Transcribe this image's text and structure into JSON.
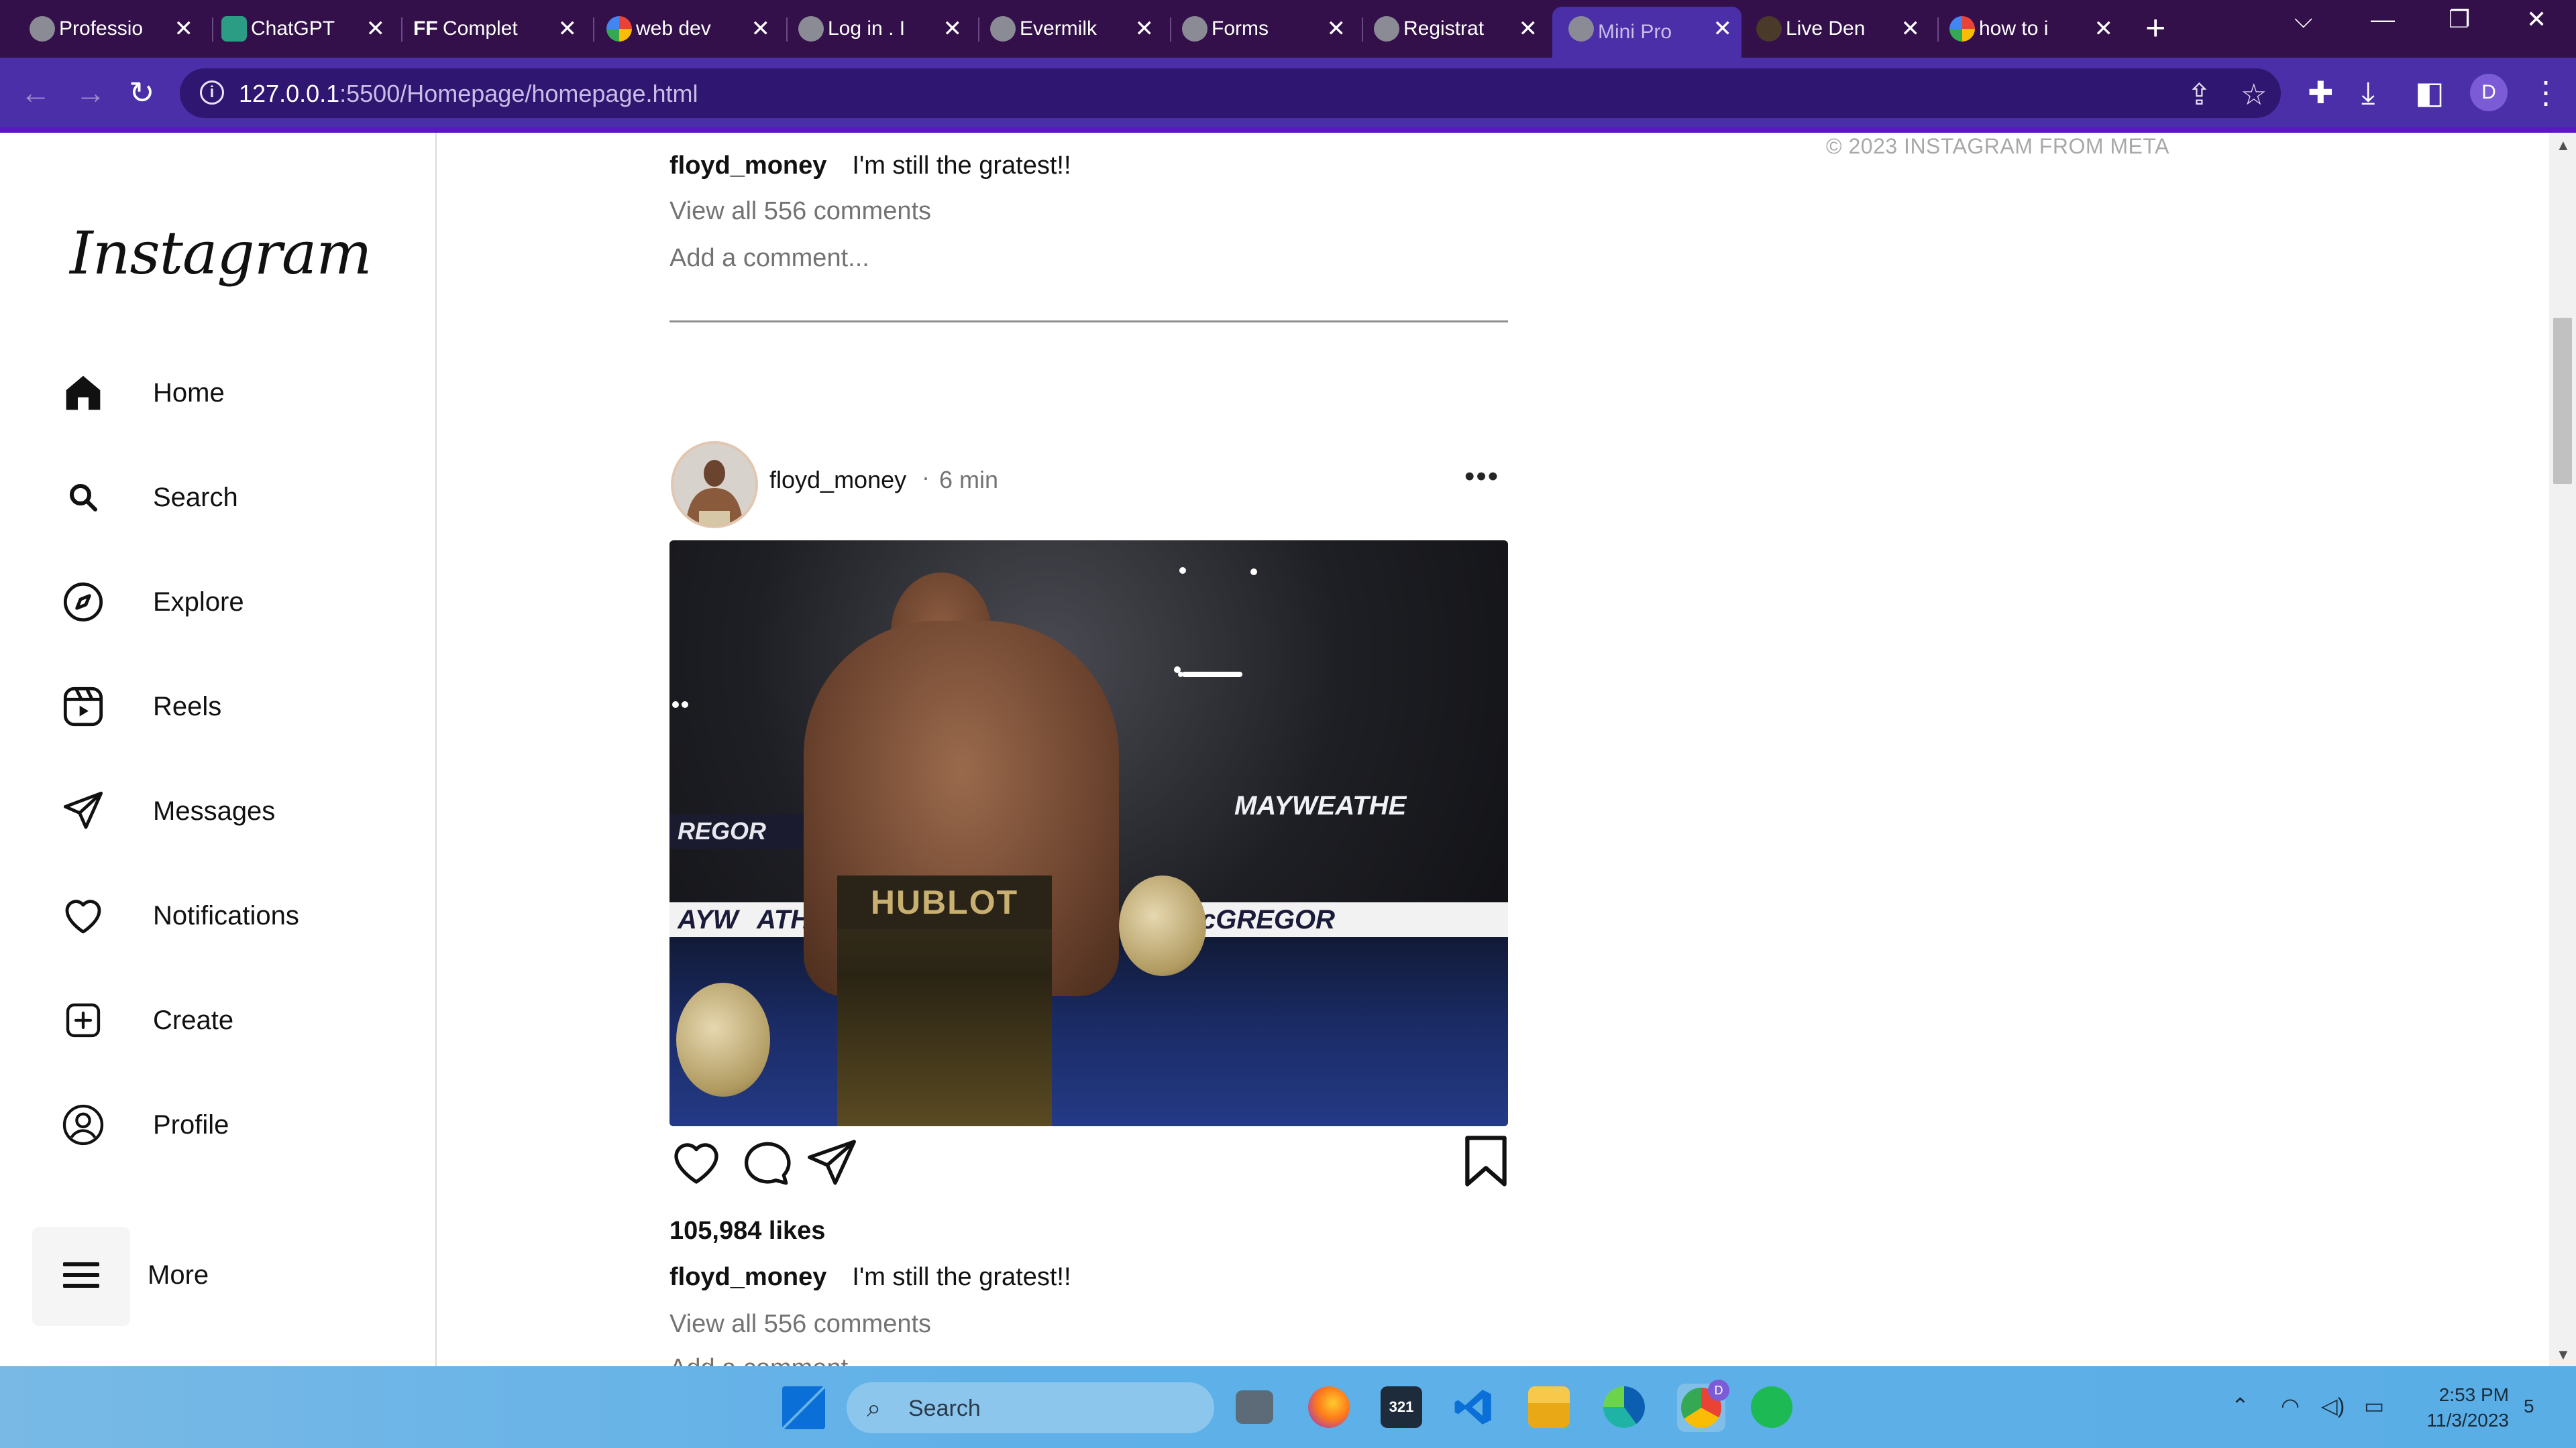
{
  "browser": {
    "tabs": [
      {
        "title": "Professio",
        "favicon": "globe-icon"
      },
      {
        "title": "ChatGPT",
        "favicon": "chatgpt-icon"
      },
      {
        "title": "Complet",
        "favicon": "ff-icon",
        "favicon_text": "FF"
      },
      {
        "title": "web dev",
        "favicon": "google-icon"
      },
      {
        "title": "Log in . I",
        "favicon": "globe-icon"
      },
      {
        "title": "Evermilk",
        "favicon": "globe-icon"
      },
      {
        "title": "Forms",
        "favicon": "globe-icon"
      },
      {
        "title": "Registrat",
        "favicon": "globe-icon"
      },
      {
        "title": "Mini Pro",
        "favicon": "globe-icon",
        "active": true
      },
      {
        "title": "Live Den",
        "favicon": "star-icon"
      },
      {
        "title": "how to i",
        "favicon": "google-icon"
      }
    ],
    "tab_close_glyph": "✕",
    "new_tab_glyph": "+",
    "url_host": "127.0.0.1",
    "url_path": ":5500/Homepage/homepage.html",
    "profile_initial": "D",
    "window_controls": {
      "chevron": "⌵",
      "minimize": "—",
      "restore": "❐",
      "close": "✕"
    }
  },
  "sidebar": {
    "logo": "Instagram",
    "items": [
      {
        "label": "Home",
        "icon": "home-icon"
      },
      {
        "label": "Search",
        "icon": "search-icon"
      },
      {
        "label": "Explore",
        "icon": "compass-icon"
      },
      {
        "label": "Reels",
        "icon": "reels-icon"
      },
      {
        "label": "Messages",
        "icon": "messages-icon"
      },
      {
        "label": "Notifications",
        "icon": "heart-icon"
      },
      {
        "label": "Create",
        "icon": "create-icon"
      },
      {
        "label": "Profile",
        "icon": "profile-icon"
      }
    ],
    "more_label": "More"
  },
  "feed": {
    "previous_post": {
      "caption_user": "floyd_money",
      "caption_text": "I'm still the gratest!!",
      "view_comments": "View all 556 comments",
      "add_comment_placeholder": "Add a comment..."
    },
    "post": {
      "username": "floyd_money",
      "separator": "·",
      "time": "6 min",
      "options_glyph": "•••",
      "image_banner_text": [
        "REGOR",
        "MAYWEATHE",
        "AYW",
        "ATH",
        "cGREGOR"
      ],
      "belt_text": "HUBLOT",
      "likes": "105,984 likes",
      "caption_user": "floyd_money",
      "caption_text": "I'm still the gratest!!",
      "view_comments": "View all 556 comments",
      "add_comment_placeholder": "Add a comment..."
    }
  },
  "right_column": {
    "copyright": "© 2023 INSTAGRAM FROM META"
  },
  "taskbar": {
    "search_placeholder": "Search",
    "time": "2:53 PM",
    "date": "11/3/2023",
    "notification_count": "5",
    "calendar_badge": "321",
    "chrome_badge": "D"
  },
  "colors": {
    "tab_strip": "#33104a",
    "toolbar": "#4a2fa8",
    "accent_rule": "#5a16c0",
    "taskbar": "#5fb0e8"
  }
}
